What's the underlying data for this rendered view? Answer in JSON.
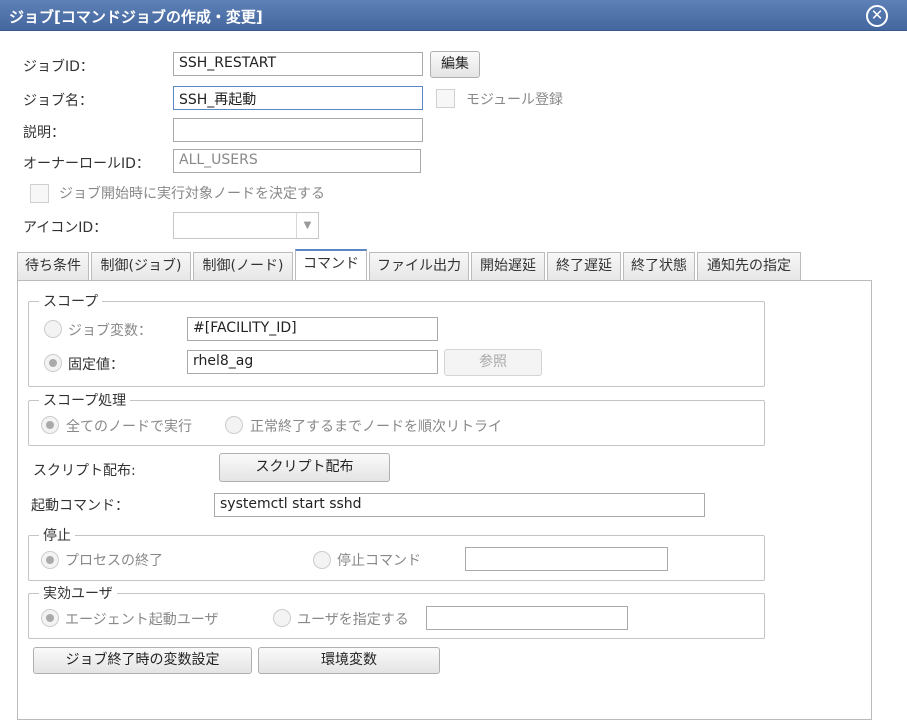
{
  "window": {
    "title": "ジョブ[コマンドジョブの作成・変更]",
    "close_glyph": "✕"
  },
  "form": {
    "job_id": {
      "label": "ジョブID：",
      "value": "SSH_RESTART",
      "edit_button": "編集"
    },
    "job_name": {
      "label": "ジョブ名：",
      "value": "SSH_再起動",
      "module_label": "モジュール登録"
    },
    "description": {
      "label": "説明：",
      "value": ""
    },
    "owner_role": {
      "label": "オーナーロールID：",
      "value": "ALL_USERS"
    },
    "decide_node_label": "ジョブ開始時に実行対象ノードを決定する",
    "icon_id": {
      "label": "アイコンID：",
      "value": ""
    }
  },
  "tabs": [
    {
      "label": "待ち条件"
    },
    {
      "label": "制御(ジョブ)"
    },
    {
      "label": "制御(ノード)"
    },
    {
      "label": "コマンド"
    },
    {
      "label": "ファイル出力"
    },
    {
      "label": "開始遅延"
    },
    {
      "label": "終了遅延"
    },
    {
      "label": "終了状態"
    },
    {
      "label": "通知先の指定"
    }
  ],
  "command_tab": {
    "scope": {
      "legend": "スコープ",
      "job_variable_label": "ジョブ変数：",
      "job_variable_value": "#[FACILITY_ID]",
      "fixed_label": "固定値：",
      "fixed_value": "rhel8_ag",
      "ref_button": "参照"
    },
    "scope_process": {
      "legend": "スコープ処理",
      "all_nodes": "全てのノードで実行",
      "retry": "正常終了するまでノードを順次リトライ"
    },
    "script": {
      "label": "スクリプト配布:",
      "button": "スクリプト配布"
    },
    "start_command": {
      "label": "起動コマンド：",
      "value": "systemctl start sshd"
    },
    "stop": {
      "legend": "停止",
      "process_end": "プロセスの終了",
      "stop_command": "停止コマンド",
      "stop_command_value": ""
    },
    "effective_user": {
      "legend": "実効ユーザ",
      "agent_user": "エージェント起動ユーザ",
      "specify_user": "ユーザを指定する",
      "user_value": ""
    },
    "buttons": {
      "var_settings": "ジョブ終了時の変数設定",
      "env_vars": "環境変数"
    }
  }
}
